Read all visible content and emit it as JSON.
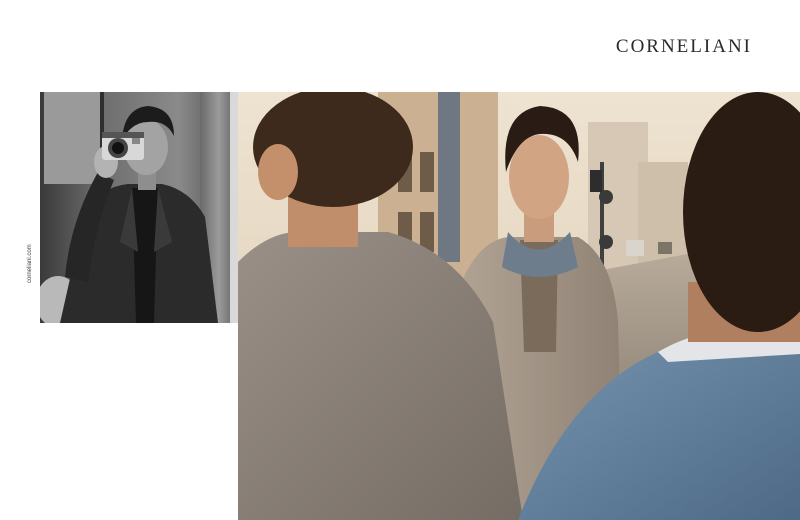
{
  "ad": {
    "brand": "CORNELIANI",
    "website": "corneliani.com"
  },
  "palette": {
    "background": "#ffffff",
    "brand_text": "#2a2a2a",
    "street_sky": "#e9dcc8",
    "building_warm": "#c9ad8a",
    "jacket_suede": "#a99a8a",
    "jacket_tweed": "#8a8178",
    "jacket_blue": "#5f7d9b"
  },
  "photos": {
    "bw": {
      "subject": "man-with-camera-icon"
    },
    "color": {
      "subject": "street-scene-icon"
    }
  }
}
